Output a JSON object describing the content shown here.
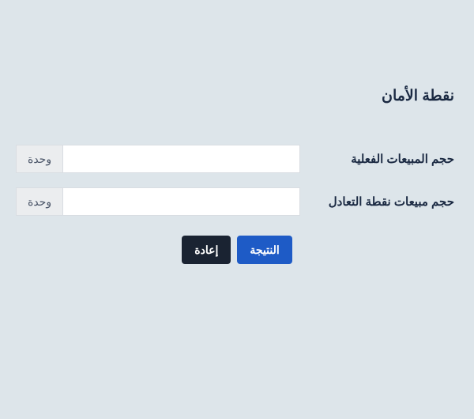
{
  "title": "نقطة الأمان",
  "fields": [
    {
      "label": "حجم المبيعات الفعلية",
      "value": "",
      "unit": "وحدة"
    },
    {
      "label": "حجم مبيعات نقطة التعادل",
      "value": "",
      "unit": "وحدة"
    }
  ],
  "buttons": {
    "result": "النتيجة",
    "reset": "إعادة"
  }
}
